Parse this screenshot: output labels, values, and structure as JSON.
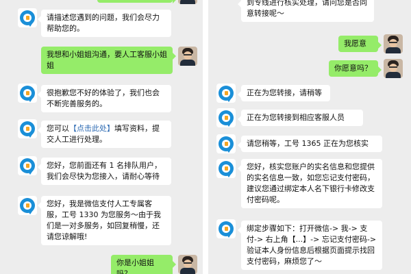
{
  "left": {
    "messages": [
      {
        "from": "user",
        "text": ""
      },
      {
        "from": "bot",
        "text": "请描述您遇到的问题，我们会尽力帮助您的。"
      },
      {
        "from": "user",
        "text": "我想和小姐姐沟通，要人工客服小姐姐"
      },
      {
        "from": "bot",
        "text": "很抱歉您不好的体验了，我们也会不断完善服务的。"
      },
      {
        "from": "bot",
        "pre": "您可以",
        "link": "【点击此处】",
        "post": "填写资料，提交人工进行处理。"
      },
      {
        "from": "bot",
        "text": "您好，您前面还有 1 名排队用户，我们会尽快为您接入，请耐心等待"
      },
      {
        "from": "bot",
        "text": "您好，我是微信支付人工专属客服，工号 1330 为您服务～由于我们是一对多服务，如回复稍慢，还请您谅解哦!"
      },
      {
        "from": "user",
        "text": "你是小姐姐吗？"
      }
    ]
  },
  "right": {
    "messages": [
      {
        "from": "bot",
        "text": "到专线进行核实处理，请问您是否同意转接呢～"
      },
      {
        "from": "user",
        "text": "我愿意"
      },
      {
        "from": "user",
        "text": "你愿意吗？"
      },
      {
        "from": "bot",
        "text": "正在为您转接，请稍等"
      },
      {
        "from": "bot",
        "text": "正在为您转接到相应客服人员"
      },
      {
        "from": "bot",
        "text": "请您稍等，工号 1365 正在为您核实"
      },
      {
        "from": "bot",
        "text": "您好，核实您账户的实名信息和您提供的实名信息一致，如您忘记支付密码，建议您通过绑定本人名下银行卡修改支付密码呢。"
      },
      {
        "from": "bot",
        "text": "绑定步骤如下：打开微信-> 我-> 支付-> 右上角【...】-> 忘记支付密码->验证本人身份信息后根据页面提示找回支付密码，麻烦您了～"
      }
    ]
  }
}
